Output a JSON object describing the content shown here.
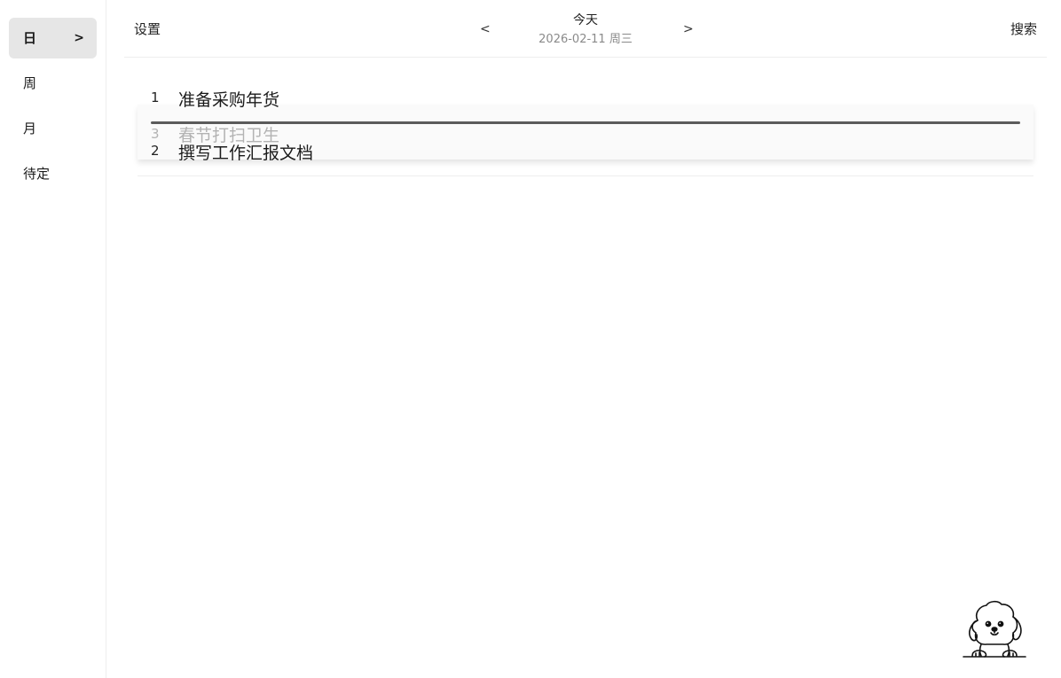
{
  "sidebar": {
    "items": [
      {
        "label": "日",
        "chevron": ">"
      },
      {
        "label": "周"
      },
      {
        "label": "月"
      },
      {
        "label": "待定"
      }
    ]
  },
  "header": {
    "settings_label": "设置",
    "prev_label": "<",
    "next_label": ">",
    "title": "今天",
    "date": "2026-02-11 周三",
    "search_label": "搜索"
  },
  "tasks": [
    {
      "num": "1",
      "title": "准备采购年货"
    },
    {
      "num": "2",
      "title": "撰写工作汇报文档"
    }
  ],
  "dragging_task": {
    "num": "3",
    "title": "春节打扫卫生"
  },
  "mascot": {
    "icon": "dog-mascot-icon"
  }
}
